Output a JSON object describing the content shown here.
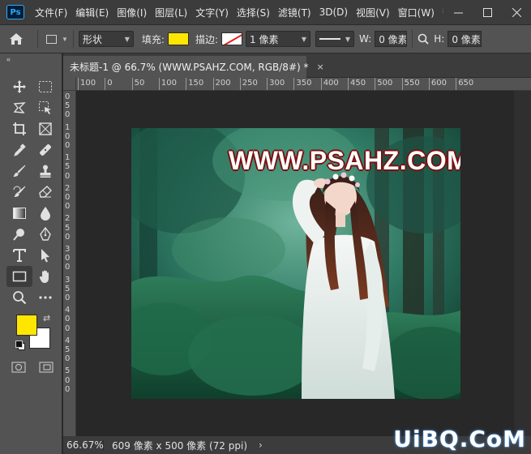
{
  "app": {
    "logo": "Ps",
    "menus": [
      "文件(F)",
      "编辑(E)",
      "图像(I)",
      "图层(L)",
      "文字(Y)",
      "选择(S)",
      "滤镜(T)",
      "3D(D)",
      "视图(V)",
      "窗口(W)",
      "帮"
    ],
    "window_controls": [
      "minimize-icon",
      "maximize-icon",
      "close-icon"
    ]
  },
  "options": {
    "mode": "形状",
    "fill_label": "填充:",
    "fill_color": "#ffe600",
    "stroke_label": "描边:",
    "stroke_width": "1 像素",
    "w_label": "W:",
    "w_value": "0 像素",
    "h_label": "H:",
    "h_value": "0 像素"
  },
  "toolbar": {
    "collapse": "«",
    "tools": [
      "move-icon",
      "marquee-icon",
      "lasso-icon",
      "object-select-icon",
      "crop-icon",
      "frame-icon",
      "eyedropper-icon",
      "healing-icon",
      "brush-icon",
      "stamp-icon",
      "history-brush-icon",
      "eraser-icon",
      "gradient-icon",
      "blur-icon",
      "dodge-icon",
      "pen-icon",
      "type-icon",
      "path-select-icon",
      "rectangle-icon",
      "hand-icon",
      "zoom-icon",
      "more-tools-icon"
    ],
    "foreground_color": "#ffe600",
    "background_color": "#ffffff"
  },
  "document": {
    "tab_title": "未标题-1 @ 66.7% (WWW.PSAHZ.COM, RGB/8#) *",
    "tab_close": "×",
    "ruler_h_labels": [
      "100",
      "0",
      "50",
      "100",
      "150",
      "200",
      "250",
      "300",
      "350",
      "400",
      "450",
      "500",
      "550",
      "600",
      "650"
    ],
    "ruler_v_digits": [
      "0",
      "5",
      "0",
      "1",
      "0",
      "0",
      "1",
      "5",
      "0",
      "2",
      "0",
      "0",
      "2",
      "5",
      "0",
      "3",
      "0",
      "0",
      "3",
      "5",
      "0",
      "4",
      "0",
      "0",
      "4",
      "5",
      "0",
      "5",
      "0",
      "0"
    ],
    "watermark_text": "WWW.PSAHZ.COM"
  },
  "status": {
    "zoom": "66.67%",
    "doc_info": "609 像素 x 500 像素 (72 ppi)",
    "arrow": "›"
  },
  "brand_mark": "UiBQ.CoM"
}
